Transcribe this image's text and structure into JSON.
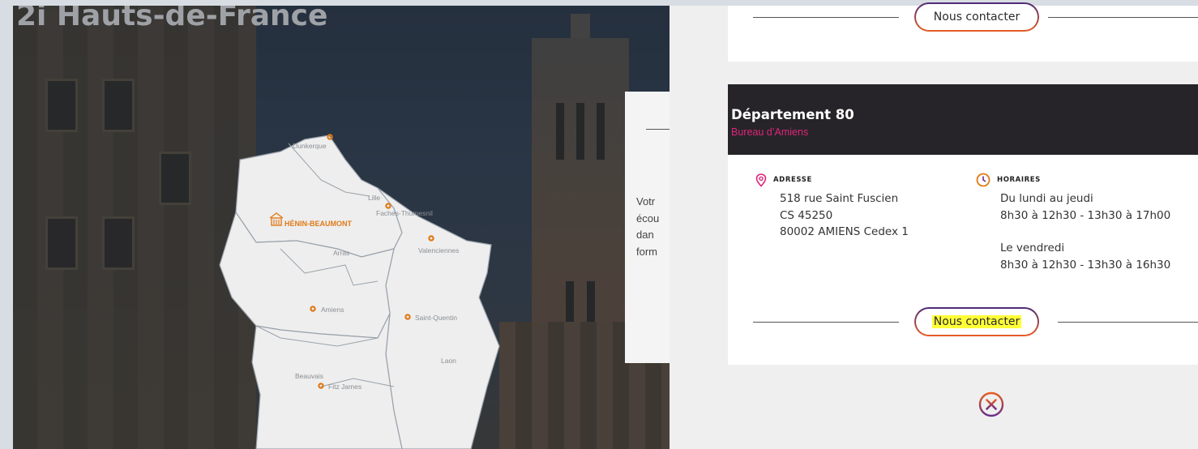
{
  "hero": {
    "title": "2i Hauts-de-France",
    "info_card_text": "Votr\nécou\ndan\nform"
  },
  "map": {
    "main_city": "HÉNIN-BEAUMONT",
    "cities": [
      "Dunkerque",
      "Lille",
      "Faches-Thumesnil",
      "Arras",
      "Valenciennes",
      "Amiens",
      "Saint-Quentin",
      "Laon",
      "Beauvais",
      "Fitz James"
    ]
  },
  "cards": {
    "top": {
      "contact_label": "Nous contacter"
    },
    "dept80": {
      "title": "Département 80",
      "subtitle": "Bureau d’Amiens",
      "address_label": "ADRESSE",
      "address_lines": [
        "518 rue Saint Fuscien",
        "CS 45250",
        "80002 AMIENS Cedex 1"
      ],
      "hours_label": "HORAIRES",
      "hours_days_1": "Du lundi au jeudi",
      "hours_time_1": "8h30 à 12h30 - 13h30 à 17h00",
      "hours_days_2": "Le vendredi",
      "hours_time_2": "8h30 à 12h30 - 13h30 à 16h30",
      "contact_label": "Nous contacter"
    }
  },
  "colors": {
    "accent_orange": "#e07a17",
    "accent_pink": "#e0257a",
    "dark_header": "#262428",
    "highlight": "#ffff38"
  },
  "icons": {
    "address": "location-pin-icon",
    "hours": "clock-icon",
    "close": "close-circle-icon"
  }
}
